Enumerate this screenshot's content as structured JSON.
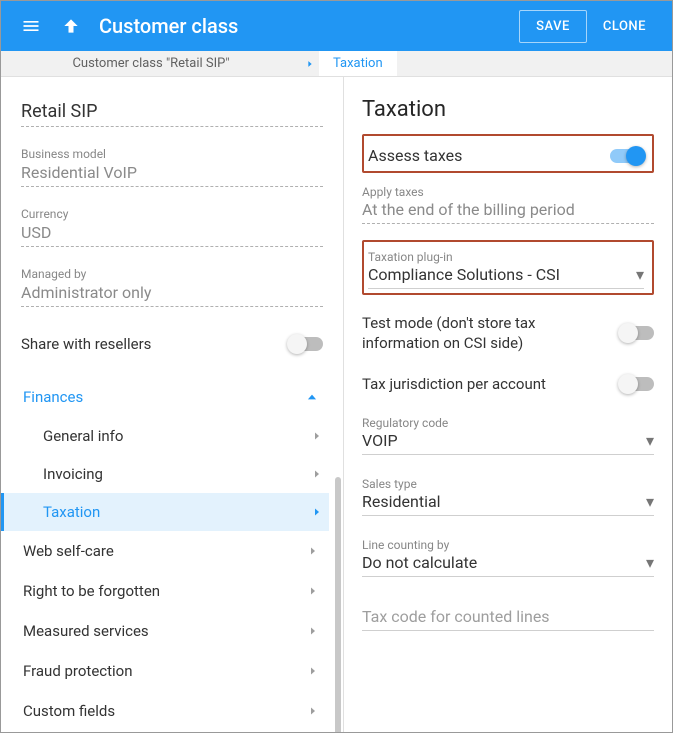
{
  "appbar": {
    "title": "Customer class",
    "save": "SAVE",
    "clone": "CLONE"
  },
  "breadcrumb": {
    "parent": "Customer class \"Retail SIP\"",
    "current": "Taxation"
  },
  "left": {
    "name": "Retail SIP",
    "business_model": {
      "label": "Business model",
      "value": "Residential VoIP"
    },
    "currency": {
      "label": "Currency",
      "value": "USD"
    },
    "managed_by": {
      "label": "Managed by",
      "value": "Administrator only"
    },
    "share_label": "Share with resellers",
    "share_on": false
  },
  "nav": {
    "finances": {
      "label": "Finances",
      "items": [
        {
          "label": "General info"
        },
        {
          "label": "Invoicing"
        },
        {
          "label": "Taxation",
          "active": true
        }
      ]
    },
    "others": [
      "Web self-care",
      "Right to be forgotten",
      "Measured services",
      "Fraud protection",
      "Custom fields"
    ]
  },
  "right": {
    "heading": "Taxation",
    "assess": {
      "label": "Assess taxes",
      "on": true
    },
    "apply": {
      "label": "Apply taxes",
      "value": "At the end of the billing period"
    },
    "plugin": {
      "label": "Taxation plug-in",
      "value": "Compliance Solutions - CSI"
    },
    "test_mode": {
      "label": "Test mode (don't store tax information on CSI side)",
      "on": false
    },
    "jurisdiction": {
      "label": "Tax jurisdiction per account",
      "on": false
    },
    "regulatory": {
      "label": "Regulatory code",
      "value": "VOIP"
    },
    "sales_type": {
      "label": "Sales type",
      "value": "Residential"
    },
    "line_counting": {
      "label": "Line counting by",
      "value": "Do not calculate"
    },
    "tax_code": {
      "label": "Tax code for counted lines",
      "value": ""
    }
  }
}
